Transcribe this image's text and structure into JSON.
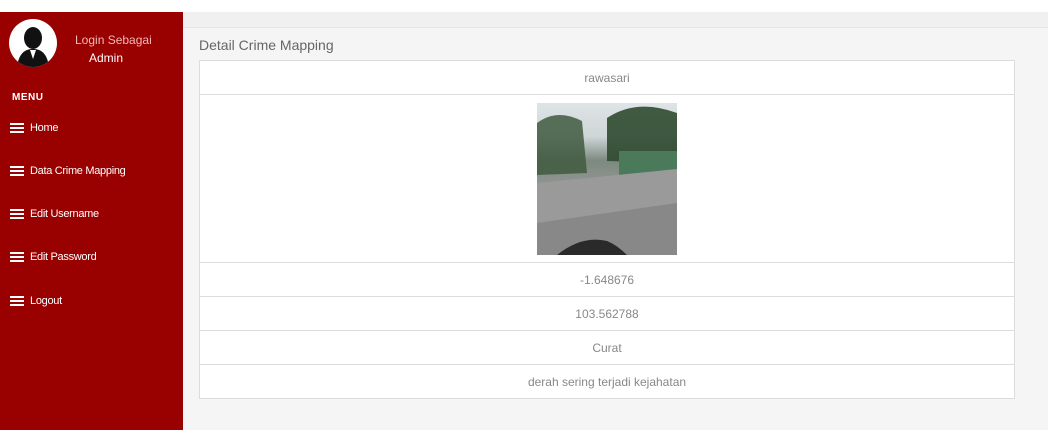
{
  "sidebar": {
    "login_label": "Login Sebagai",
    "user": "Admin",
    "menu_header": "MENU",
    "items": [
      {
        "label": "Home",
        "icon": "list-icon"
      },
      {
        "label": "Data Crime Mapping",
        "icon": "list-icon"
      },
      {
        "label": "Edit Username",
        "icon": "list-icon"
      },
      {
        "label": "Edit Password",
        "icon": "list-icon"
      },
      {
        "label": "Logout",
        "icon": "list-icon"
      }
    ]
  },
  "main": {
    "title": "Detail Crime Mapping",
    "detail": {
      "location": "rawasari",
      "latitude": "-1.648676",
      "longitude": "103.562788",
      "category": "Curat",
      "description": "derah sering terjadi kejahatan"
    }
  },
  "colors": {
    "sidebar_bg": "#990000",
    "content_bg": "#f5f5f5",
    "text_muted": "#888888"
  }
}
